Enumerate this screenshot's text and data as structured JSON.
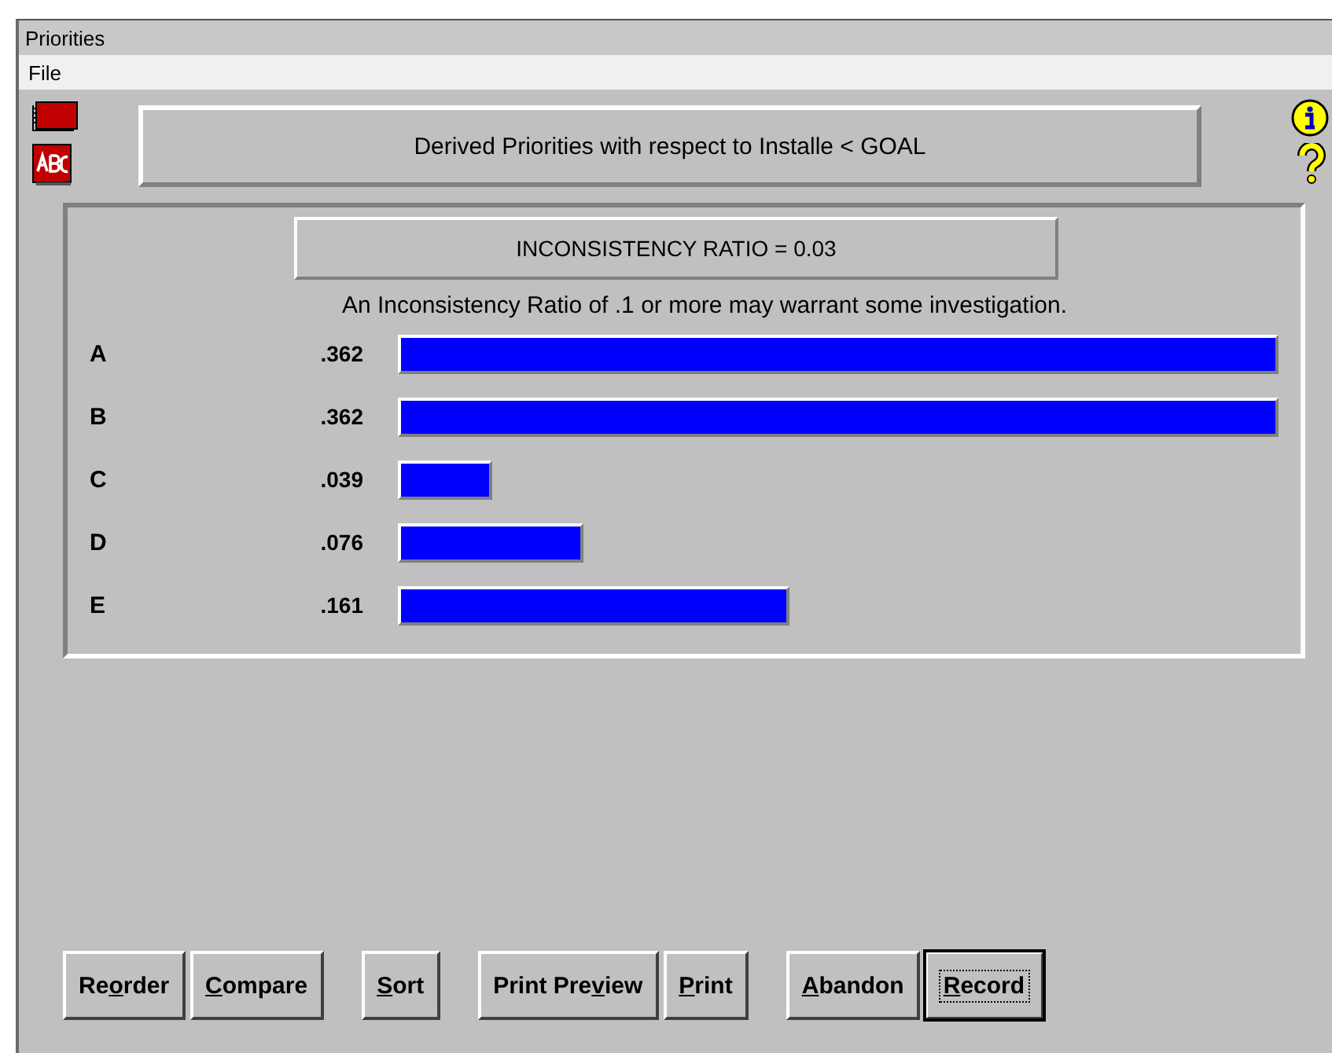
{
  "window": {
    "title": "Priorities"
  },
  "menu": [
    "File"
  ],
  "header": {
    "title": "Derived Priorities with respect to Installe < GOAL"
  },
  "inconsistency": {
    "ratio": "INCONSISTENCY RATIO = 0.03",
    "note": "An Inconsistency Ratio of .1 or more may warrant some investigation."
  },
  "priorities": [
    {
      "name": "A",
      "value": ".362"
    },
    {
      "name": "B",
      "value": ".362"
    },
    {
      "name": "C",
      "value": ".039"
    },
    {
      "name": "D",
      "value": ".076"
    },
    {
      "name": "E",
      "value": ".161"
    }
  ],
  "buttons": [
    {
      "label": {
        "pre": "Re",
        "key": "o",
        "post": "rder"
      },
      "default": false
    },
    {
      "label": {
        "key": "C",
        "post": "ompare"
      },
      "default": false
    },
    {
      "label": {
        "key": "S",
        "post": "ort"
      },
      "default": false
    },
    {
      "label": {
        "pre": "Print Pre",
        "key": "v",
        "post": "iew"
      },
      "default": false
    },
    {
      "label": {
        "key": "P",
        "post": "rint"
      },
      "default": false
    },
    {
      "label": {
        "key": "A",
        "post": "bandon"
      },
      "default": false
    },
    {
      "label": {
        "key": "R",
        "post": "ecord"
      },
      "default": true
    }
  ]
}
